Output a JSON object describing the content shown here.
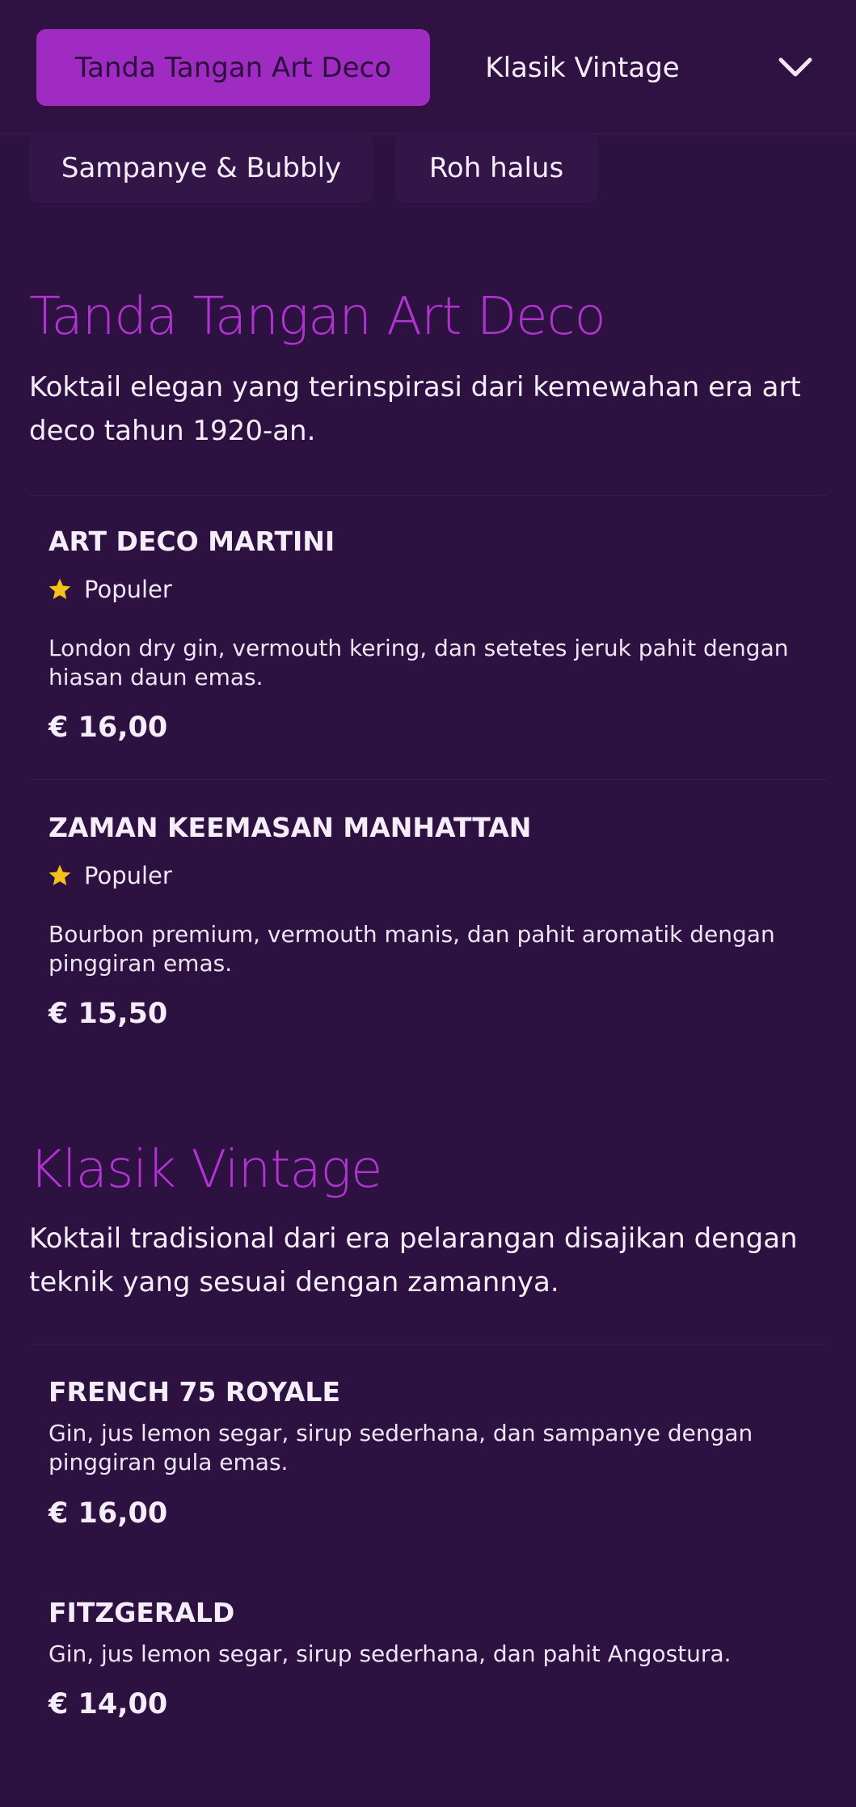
{
  "nav": {
    "tabs": [
      {
        "label": "Tanda Tangan Art Deco",
        "active": true
      },
      {
        "label": "Klasik Vintage",
        "active": false
      },
      {
        "label": "Sampanye & Bubbly",
        "active": false
      },
      {
        "label": "Roh halus",
        "active": false
      }
    ],
    "expand_icon": "chevron-down-icon"
  },
  "sections": [
    {
      "title": "Tanda Tangan Art Deco",
      "description": "Koktail elegan yang terinspirasi dari kemewahan era art deco tahun 1920-an.",
      "items": [
        {
          "name": "ART DECO MARTINI",
          "badge": "Populer",
          "description": "London dry gin, vermouth kering, dan setetes jeruk pahit dengan hiasan daun emas.",
          "price": "€ 16,00"
        },
        {
          "name": "ZAMAN KEEMASAN MANHATTAN",
          "badge": "Populer",
          "description": "Bourbon premium, vermouth manis, dan pahit aromatik dengan pinggiran emas.",
          "price": "€ 15,50"
        }
      ]
    },
    {
      "title": "Klasik Vintage",
      "description": "Koktail tradisional dari era pelarangan disajikan dengan teknik yang sesuai dengan zamannya.",
      "items": [
        {
          "name": "FRENCH 75 ROYALE",
          "description": "Gin, jus lemon segar, sirup sederhana, dan sampanye dengan pinggiran gula emas.",
          "price": "€ 16,00"
        },
        {
          "name": "FITZGERALD",
          "description": "Gin, jus lemon segar, sirup sederhana, dan pahit Angostura.",
          "price": "€ 14,00"
        }
      ]
    }
  ],
  "colors": {
    "background": "#2d1140",
    "accent": "#a02bc2",
    "title": "#b133d1",
    "star": "#f4c21a"
  }
}
